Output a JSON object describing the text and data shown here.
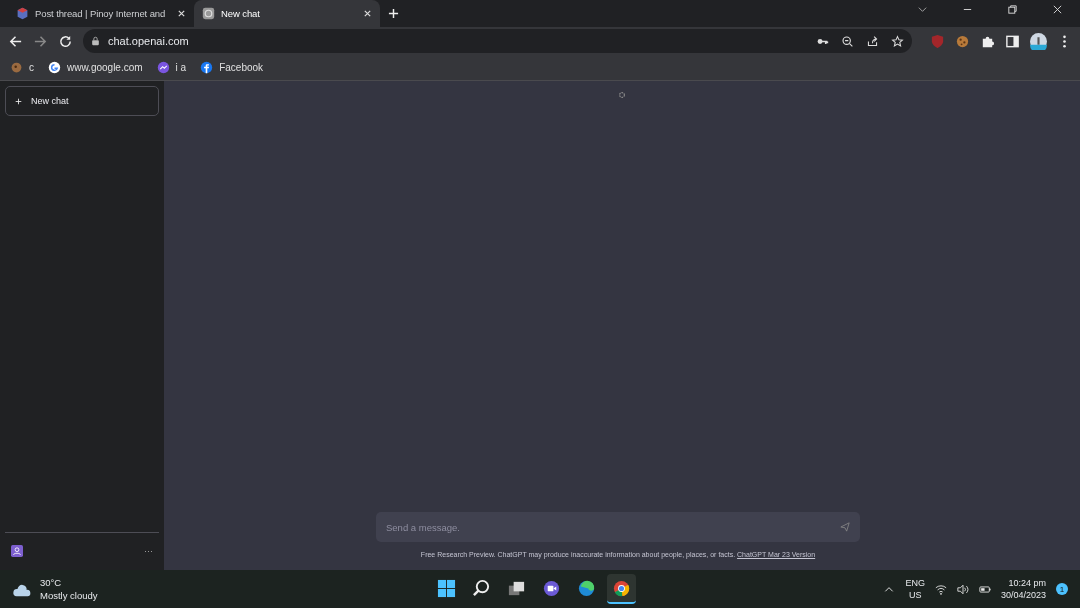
{
  "tabs": [
    {
      "title": "Post thread | Pinoy Internet and",
      "selected": false
    },
    {
      "title": "New chat",
      "selected": true
    }
  ],
  "address": {
    "url": "chat.openai.com"
  },
  "bookmarks": [
    {
      "label": "c"
    },
    {
      "label": "www.google.com"
    },
    {
      "label": "i a"
    },
    {
      "label": "Facebook"
    }
  ],
  "sidebar": {
    "new_chat": "New chat",
    "more": "···"
  },
  "composer": {
    "placeholder": "Send a message."
  },
  "footer": {
    "text": "Free Research Preview. ChatGPT may produce inaccurate information about people, places, or facts.",
    "link": "ChatGPT Mar 23 Version"
  },
  "taskbar": {
    "weather": {
      "temp": "30°C",
      "condition": "Mostly cloudy"
    },
    "apps": [
      {
        "kind": "start",
        "selected": false
      },
      {
        "kind": "search",
        "selected": false
      },
      {
        "kind": "taskview",
        "selected": false
      },
      {
        "kind": "meet",
        "selected": false
      },
      {
        "kind": "edge",
        "selected": false
      },
      {
        "kind": "chrome",
        "selected": true
      }
    ],
    "language": [
      "ENG",
      "US"
    ],
    "time": "10:24 pm",
    "date": "30/04/2023",
    "notifications": "1"
  }
}
